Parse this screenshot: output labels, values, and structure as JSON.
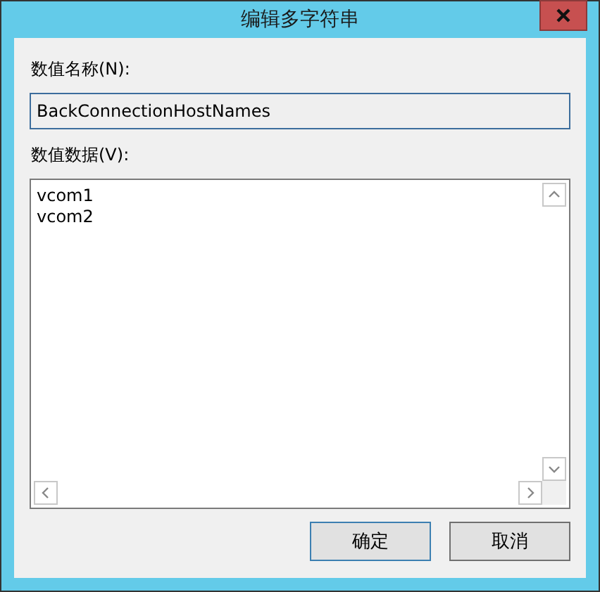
{
  "window": {
    "title": "编辑多字符串"
  },
  "name_field": {
    "label": "数值名称(N):",
    "value": "BackConnectionHostNames"
  },
  "data_field": {
    "label": "数值数据(V):",
    "lines": [
      "vcom1",
      "vcom2"
    ]
  },
  "buttons": [
    {
      "label": "确定",
      "default": true
    },
    {
      "label": "取消",
      "default": false
    }
  ]
}
